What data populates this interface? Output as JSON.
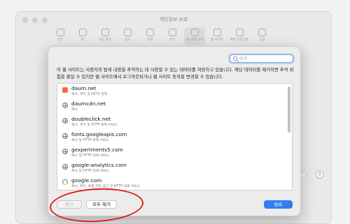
{
  "window": {
    "title": "개인정보 보호",
    "toolbar": [
      "일반",
      "탭",
      "자동 완성",
      "암호",
      "검색",
      "보안",
      "개인정보 보호",
      "웹 사이트",
      "확장 프로그램",
      "고급"
    ],
    "help_label": "?"
  },
  "sheet": {
    "search": {
      "placeholder": "검색",
      "value": ""
    },
    "description": "이 웹 사이트는 사용자의 탐색 내용을 추적하는 데 사용할 수 있는 데이터를 저장하고 있습니다. 해당 데이터를 제거하면 추적 위험을 줄일 수 있지만 웹 사이트에서 로그아웃되거나 웹 사이트 동작을 변경할 수 있습니다.",
    "sites": [
      {
        "name": "daum.net",
        "detail": "캐시, 쿠키 및 HSTS 정책",
        "icon": "daum-icon"
      },
      {
        "name": "daumcdn.net",
        "detail": "캐시",
        "icon": "globe-icon"
      },
      {
        "name": "doubleclick.net",
        "detail": "캐시, 쿠키 및 HTTP 대체 서비스",
        "icon": "globe-icon"
      },
      {
        "name": "fonts.googleapis.com",
        "detail": "캐시 및 HTTP 대체 서비스",
        "icon": "globe-icon"
      },
      {
        "name": "gexperiments5.com",
        "detail": "캐시 및 HTTP 대체 서비스",
        "icon": "globe-icon"
      },
      {
        "name": "google-analytics.com",
        "detail": "캐시 및 HTTP 대체 서비스",
        "icon": "globe-icon"
      },
      {
        "name": "google.com",
        "detail": "캐시, 쿠키, 로컬 저장 공간 및 HTTP 대체 서비스",
        "icon": "google-icon"
      }
    ],
    "buttons": {
      "remove": "제거",
      "remove_all": "모두 제거",
      "done": "완료"
    }
  },
  "colors": {
    "accent": "#2f7ff0",
    "annotation": "#e02020",
    "daum": "#f56b3f"
  }
}
